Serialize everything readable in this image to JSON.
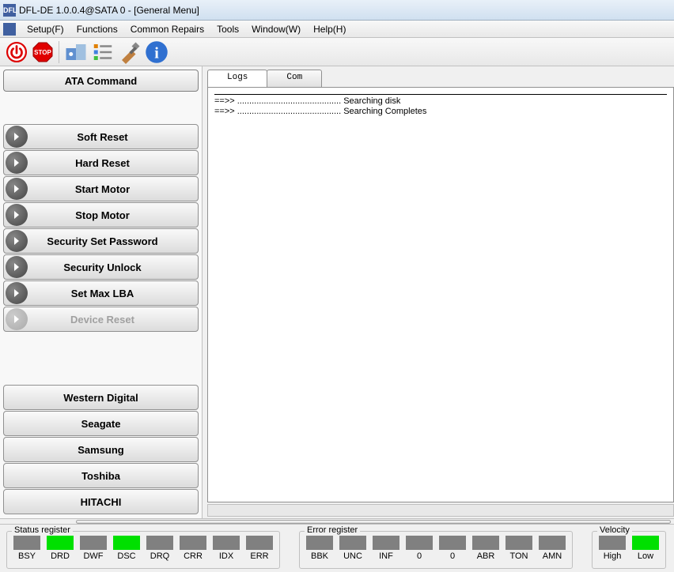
{
  "title": "DFL-DE 1.0.0.4@SATA 0 - [General Menu]",
  "menus": [
    "Setup(F)",
    "Functions",
    "Common Repairs",
    "Tools",
    "Window(W)",
    "Help(H)"
  ],
  "toolbar": {
    "power": "power-icon",
    "stop": "STOP",
    "tools": "tools-icon",
    "info": "info-icon"
  },
  "ata_command_label": "ATA Command",
  "commands": [
    {
      "label": "Soft Reset",
      "enabled": true
    },
    {
      "label": "Hard Reset",
      "enabled": true
    },
    {
      "label": "Start Motor",
      "enabled": true
    },
    {
      "label": "Stop Motor",
      "enabled": true
    },
    {
      "label": "Security Set Password",
      "enabled": true
    },
    {
      "label": "Security Unlock",
      "enabled": true
    },
    {
      "label": "Set Max LBA",
      "enabled": true
    },
    {
      "label": "Device Reset",
      "enabled": false
    }
  ],
  "vendors": [
    "Western Digital",
    "Seagate",
    "Samsung",
    "Toshiba",
    "HITACHI"
  ],
  "tabs": [
    {
      "label": "Logs",
      "active": true
    },
    {
      "label": "Com",
      "active": false
    }
  ],
  "log_lines": [
    "==>> ........................................... Searching disk",
    "==>> ........................................... Searching Completes"
  ],
  "status_register": {
    "label": "Status register",
    "cells": [
      {
        "name": "BSY",
        "on": false
      },
      {
        "name": "DRD",
        "on": true
      },
      {
        "name": "DWF",
        "on": false
      },
      {
        "name": "DSC",
        "on": true
      },
      {
        "name": "DRQ",
        "on": false
      },
      {
        "name": "CRR",
        "on": false
      },
      {
        "name": "IDX",
        "on": false
      },
      {
        "name": "ERR",
        "on": false
      }
    ]
  },
  "error_register": {
    "label": "Error register",
    "cells": [
      {
        "name": "BBK",
        "on": false
      },
      {
        "name": "UNC",
        "on": false
      },
      {
        "name": "INF",
        "on": false
      },
      {
        "name": "0",
        "on": false
      },
      {
        "name": "0",
        "on": false
      },
      {
        "name": "ABR",
        "on": false
      },
      {
        "name": "TON",
        "on": false
      },
      {
        "name": "AMN",
        "on": false
      }
    ]
  },
  "velocity": {
    "label": "Velocity",
    "cells": [
      {
        "name": "High",
        "on": false
      },
      {
        "name": "Low",
        "on": true
      }
    ]
  }
}
